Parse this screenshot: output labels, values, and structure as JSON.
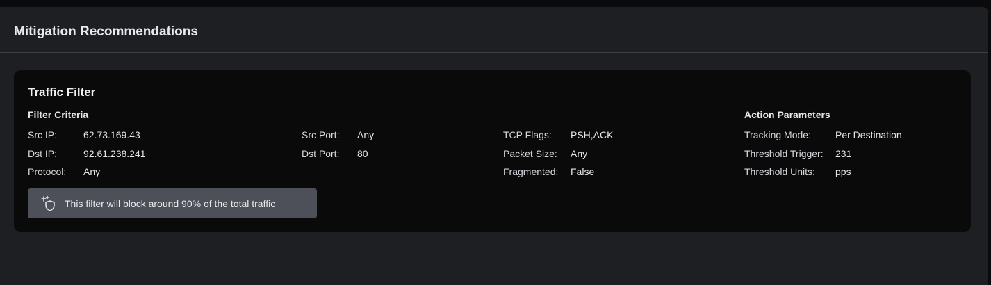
{
  "panel": {
    "title": "Mitigation Recommendations"
  },
  "card": {
    "title": "Traffic Filter",
    "filter_criteria": {
      "title": "Filter Criteria",
      "col1": [
        {
          "label": "Src IP:",
          "value": "62.73.169.43"
        },
        {
          "label": "Dst IP:",
          "value": "92.61.238.241"
        },
        {
          "label": "Protocol:",
          "value": "Any"
        }
      ],
      "col2": [
        {
          "label": "Src Port:",
          "value": "Any"
        },
        {
          "label": "Dst Port:",
          "value": "80"
        }
      ],
      "col3": [
        {
          "label": "TCP Flags:",
          "value": "PSH,ACK"
        },
        {
          "label": "Packet Size:",
          "value": "Any"
        },
        {
          "label": "Fragmented:",
          "value": "False"
        }
      ]
    },
    "action_parameters": {
      "title": "Action Parameters",
      "items": [
        {
          "label": "Tracking Mode:",
          "value": "Per Destination"
        },
        {
          "label": "Threshold Trigger:",
          "value": "231"
        },
        {
          "label": "Threshold Units:",
          "value": "pps"
        }
      ]
    },
    "banner": {
      "icon": "shield-sparkle-icon",
      "text": "This filter will block around 90% of the total traffic"
    }
  }
}
